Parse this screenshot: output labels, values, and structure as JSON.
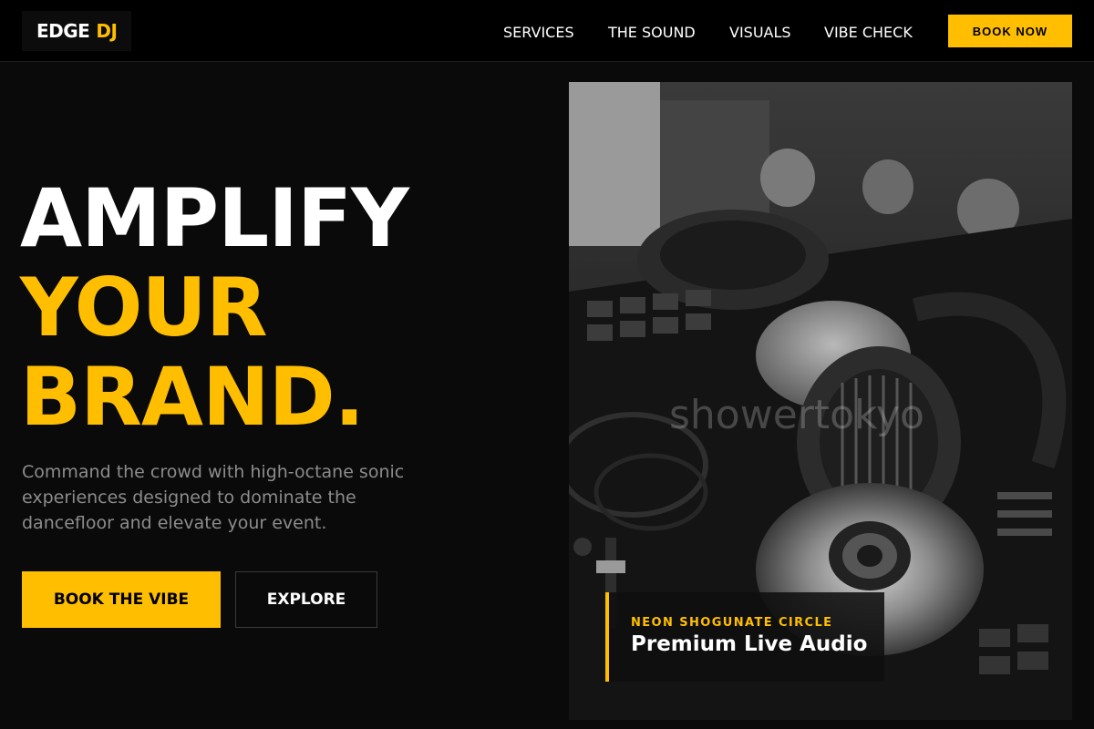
{
  "nav": {
    "logo_main": "EDGE",
    "logo_accent": "DJ",
    "items": [
      {
        "label": "SERVICES"
      },
      {
        "label": "THE SOUND"
      },
      {
        "label": "VISUALS"
      },
      {
        "label": "VIBE CHECK"
      }
    ],
    "cta_label": "BOOK NOW"
  },
  "hero": {
    "line1": "AMPLIFY",
    "line2": "YOUR",
    "line3": "BRAND.",
    "subtitle": "Command the crowd with high-octane sonic experiences designed to dominate the dancefloor and elevate your event.",
    "primary_cta": "BOOK THE VIBE",
    "secondary_cta": "EXPLORE"
  },
  "feature": {
    "watermark": "showertokyo",
    "caption_kicker": "NEON SHOGUNATE CIRCLE",
    "caption_title": "Premium Live Audio"
  },
  "colors": {
    "accent": "#ffbf00",
    "background": "#0a0a0a",
    "nav_bg": "#000000"
  }
}
